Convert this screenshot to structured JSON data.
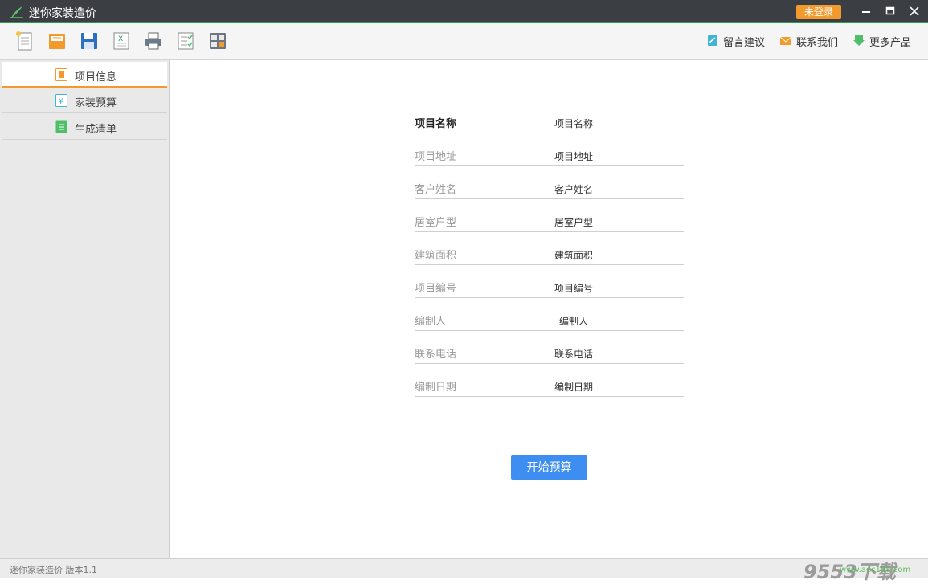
{
  "titlebar": {
    "title": "迷你家装造价",
    "login_label": "未登录"
  },
  "toolbar": {
    "tools": [
      {
        "name": "new-icon"
      },
      {
        "name": "open-icon"
      },
      {
        "name": "save-icon"
      },
      {
        "name": "excel-icon"
      },
      {
        "name": "print-icon"
      },
      {
        "name": "checklist-icon"
      },
      {
        "name": "calculator-icon"
      }
    ],
    "links": [
      {
        "label": "留言建议",
        "icon": "edit-icon"
      },
      {
        "label": "联系我们",
        "icon": "mail-icon"
      },
      {
        "label": "更多产品",
        "icon": "download-icon"
      }
    ]
  },
  "sidebar": {
    "items": [
      {
        "label": "项目信息",
        "active": true,
        "color": "#f39a2c"
      },
      {
        "label": "家装预算",
        "active": false,
        "color": "#3fb4d6"
      },
      {
        "label": "生成清单",
        "active": false,
        "color": "#4fbf6a"
      }
    ]
  },
  "form": {
    "fields": [
      {
        "label": "项目名称",
        "value": "项目名称"
      },
      {
        "label": "项目地址",
        "value": "项目地址"
      },
      {
        "label": "客户姓名",
        "value": "客户姓名"
      },
      {
        "label": "居室户型",
        "value": "居室户型"
      },
      {
        "label": "建筑面积",
        "value": "建筑面积"
      },
      {
        "label": "项目编号",
        "value": "项目编号"
      },
      {
        "label": "编制人",
        "value": "编制人"
      },
      {
        "label": "联系电话",
        "value": "联系电话"
      },
      {
        "label": "编制日期",
        "value": "编制日期"
      }
    ],
    "start_button": "开始预算"
  },
  "statusbar": {
    "text": "迷你家装造价  版本1.1",
    "watermark": "9553下载",
    "watermark_url": "www.aec188.com"
  },
  "colors": {
    "titlebar": "#3b3f44",
    "accent": "#f39a2c",
    "primary_button": "#3d8ef0"
  }
}
